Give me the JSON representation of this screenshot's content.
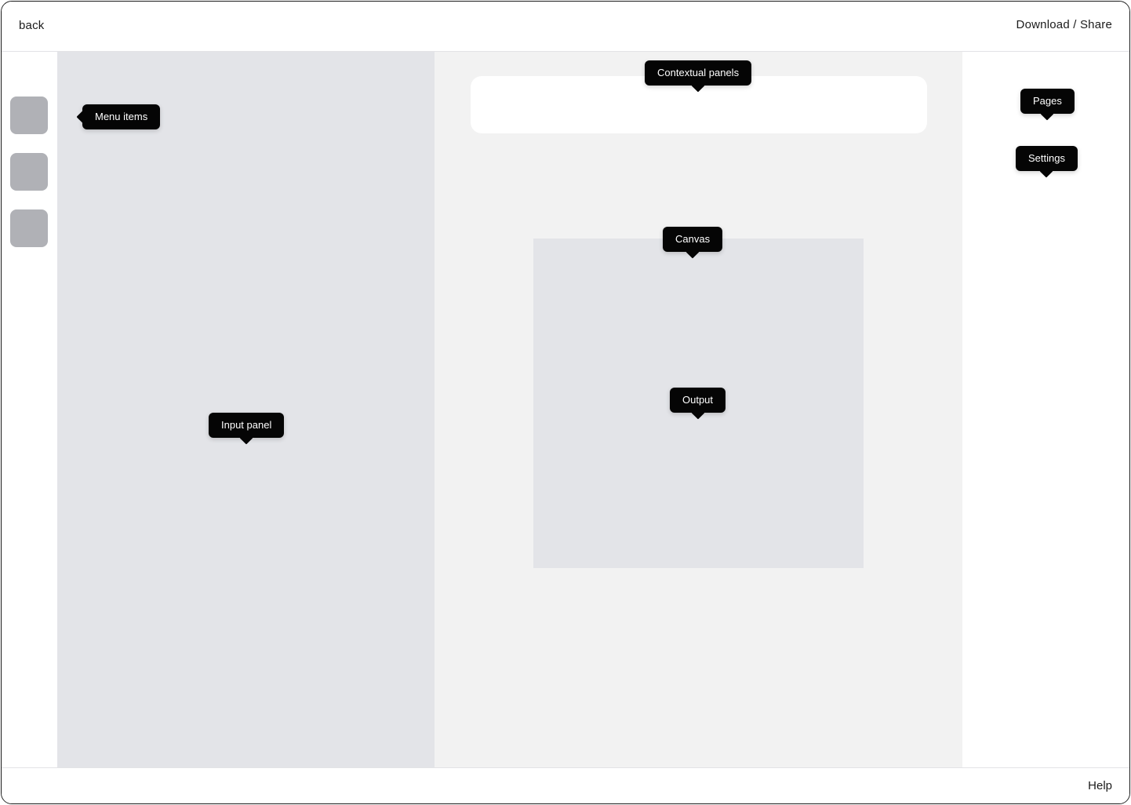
{
  "header": {
    "back_label": "back",
    "download_share_label": "Download / Share"
  },
  "rail": {
    "items": [
      {
        "icon": "menu-item-placeholder"
      },
      {
        "icon": "menu-item-placeholder"
      },
      {
        "icon": "menu-item-placeholder"
      }
    ]
  },
  "annotations": {
    "menu_items": "Menu items",
    "input_panel": "Input panel",
    "contextual_panels": "Contextual panels",
    "canvas": "Canvas",
    "output": "Output",
    "pages": "Pages",
    "settings": "Settings"
  },
  "footer": {
    "help_label": "Help"
  },
  "colors": {
    "panel_gray": "#e3e4e8",
    "workspace_gray": "#f2f2f2",
    "rail_button": "#b0b1b6",
    "tooltip_bg": "#050505"
  }
}
